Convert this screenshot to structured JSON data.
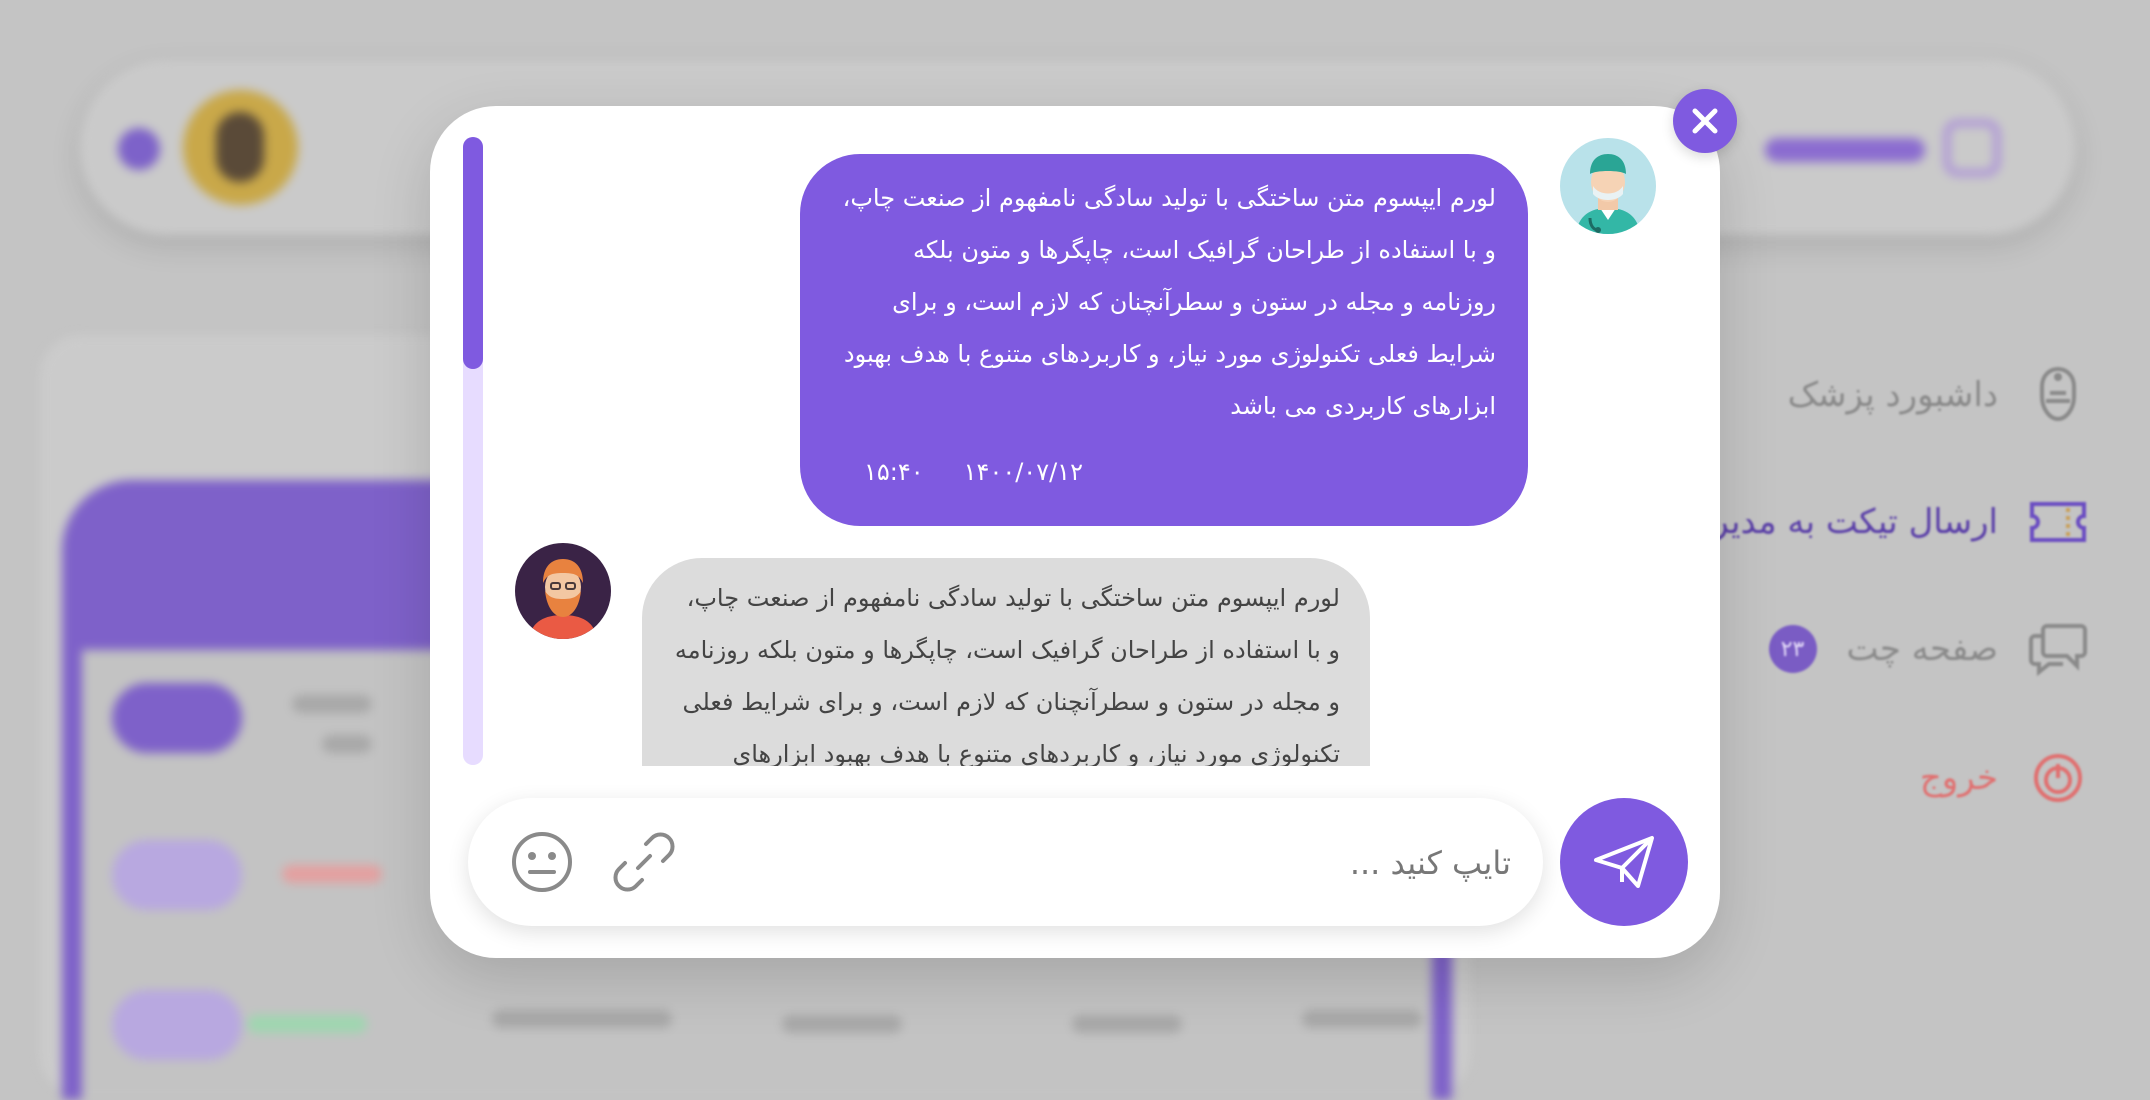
{
  "sidebar": {
    "items": [
      {
        "label": "داشبورد پزشک",
        "icon": "doctor-icon"
      },
      {
        "label": "ارسال تیکت به مدیریت",
        "icon": "ticket-icon"
      },
      {
        "label": "صفحه چت",
        "icon": "chat-icon",
        "badge": "۲۳"
      },
      {
        "label": "خروج",
        "icon": "power-icon"
      }
    ]
  },
  "chat": {
    "messages": [
      {
        "sender": "doctor",
        "avatar": "doctor-avatar",
        "text": "لورم ایپسوم متن ساختگی با تولید سادگی نامفهوم از صنعت چاپ، و با استفاده از طراحان گرافیک است، چاپگرها و متون بلکه روزنامه و مجله در ستون و سطرآنچنان که لازم است، و برای شرایط فعلی تکنولوژی مورد نیاز، و کاربردهای متنوع با هدف بهبود ابزارهای کاربردی می باشد",
        "date": "۱۴۰۰/۰۷/۱۲",
        "time": "۱۵:۴۰"
      },
      {
        "sender": "patient",
        "avatar": "patient-avatar",
        "text": "لورم ایپسوم متن ساختگی با تولید سادگی نامفهوم از صنعت چاپ، و با استفاده از طراحان گرافیک است، چاپگرها و متون بلکه روزنامه و مجله در ستون و سطرآنچنان که لازم است، و برای شرایط فعلی تکنولوژی مورد نیاز، و کاربردهای متنوع با هدف بهبود ابزارهای"
      }
    ]
  },
  "composer": {
    "placeholder": "تایپ کنید ...",
    "value": ""
  },
  "colors": {
    "accent": "#7f5ae0",
    "incoming_bubble": "#dcdcdc",
    "logout": "#e07070"
  }
}
